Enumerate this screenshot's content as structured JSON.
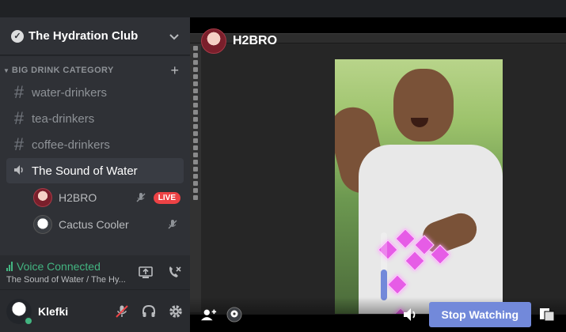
{
  "server": {
    "name": "The Hydration Club"
  },
  "category": {
    "label": "BIG DRINK CATEGORY"
  },
  "channels": [
    {
      "name": "water-drinkers",
      "type": "text"
    },
    {
      "name": "tea-drinkers",
      "type": "text"
    },
    {
      "name": "coffee-drinkers",
      "type": "text"
    },
    {
      "name": "The Sound of Water",
      "type": "voice"
    }
  ],
  "voice_users": [
    {
      "name": "H2BRO",
      "badge": "LIVE"
    },
    {
      "name": "Cactus Cooler",
      "badge": ""
    }
  ],
  "voice_panel": {
    "status": "Voice Connected",
    "subtitle": "The Sound of Water / The Hy..."
  },
  "user": {
    "name": "Klefki",
    "status_color": "#43b581"
  },
  "stream": {
    "streamer": "H2BRO",
    "stop_label": "Stop Watching",
    "volume_level": 0.45
  },
  "colors": {
    "accent": "#7289da",
    "live": "#ed4245",
    "connected": "#43b581"
  }
}
